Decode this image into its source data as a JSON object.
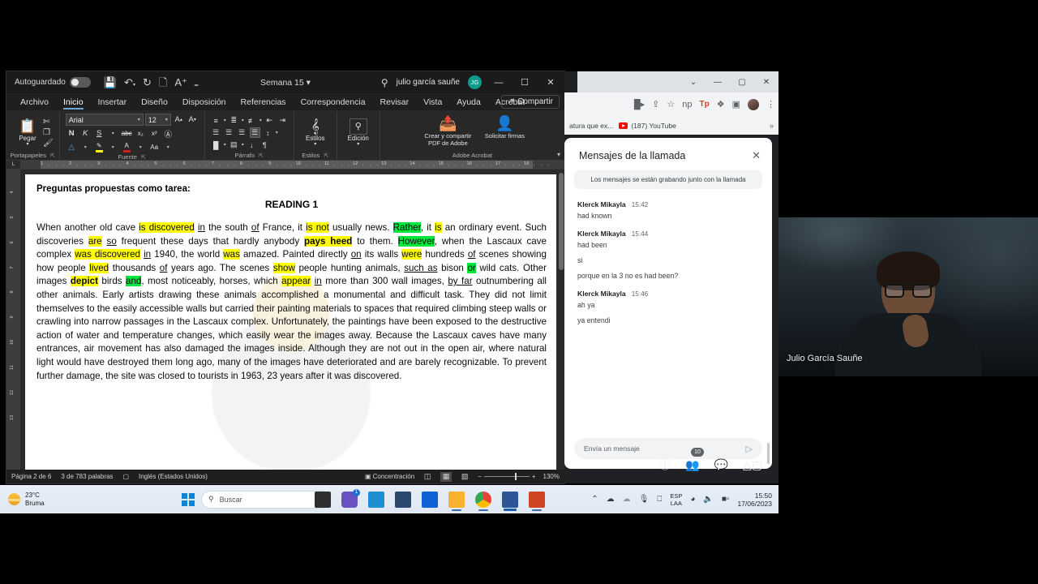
{
  "word": {
    "titlebar": {
      "autosave_label": "Autoguardado",
      "doc_title": "Semana 15",
      "doc_title_caret": "▾",
      "user_name": "julio garcía sauñe",
      "avatar_initials": "JG",
      "minimize": "—",
      "maximize": "☐",
      "close": "✕",
      "qat": [
        "save-icon",
        "undo-icon",
        "redo-icon",
        "new-icon",
        "read-aloud-icon",
        "customize-qat-icon"
      ],
      "search_icon": "search-icon"
    },
    "tabs": [
      {
        "label": "Archivo",
        "active": false
      },
      {
        "label": "Inicio",
        "active": true
      },
      {
        "label": "Insertar",
        "active": false
      },
      {
        "label": "Diseño",
        "active": false
      },
      {
        "label": "Disposición",
        "active": false
      },
      {
        "label": "Referencias",
        "active": false
      },
      {
        "label": "Correspondencia",
        "active": false
      },
      {
        "label": "Revisar",
        "active": false
      },
      {
        "label": "Vista",
        "active": false
      },
      {
        "label": "Ayuda",
        "active": false
      },
      {
        "label": "Acrobat",
        "active": false
      }
    ],
    "share_label": "Compartir",
    "ribbon": {
      "clipboard": {
        "label": "Portapapeles",
        "paste_label": "Pegar",
        "paste_caret": "▾",
        "cut_icon": "scissors-icon",
        "copy_icon": "copy-icon",
        "format_painter_icon": "format-painter-icon"
      },
      "font": {
        "label": "Fuente",
        "font_name": "Arial",
        "font_size": "12",
        "bold": "N",
        "italic": "K",
        "underline": "S",
        "strikethrough": "abc",
        "subscript": "x₂",
        "superscript": "x²",
        "clear_format_icon": "clear-formatting-icon",
        "text_effects_icon": "text-effects-icon",
        "highlight_icon": "highlight-color-icon",
        "font_color_icon": "font-color-icon",
        "change_case": "Aa",
        "grow_font": "A",
        "shrink_font": "A"
      },
      "paragraph": {
        "label": "Párrafo",
        "bullets_icon": "bullets-icon",
        "numbering_icon": "numbering-icon",
        "multilevel_icon": "multilevel-list-icon",
        "decrease_indent_icon": "decrease-indent-icon",
        "increase_indent_icon": "increase-indent-icon",
        "align_left_icon": "align-left-icon",
        "align_center_icon": "align-center-icon",
        "align_right_icon": "align-right-icon",
        "justify_icon": "justify-icon",
        "line_spacing_icon": "line-spacing-icon",
        "shading_icon": "shading-icon",
        "borders_icon": "borders-icon",
        "sort_icon": "sort-icon",
        "show_marks_icon": "show-formatting-marks-icon"
      },
      "styles": {
        "label": "Estilos",
        "button_label": "Estilos",
        "caret": "▾"
      },
      "editing": {
        "label": "Edición",
        "button_label": "Edición",
        "caret": "▾"
      },
      "acrobat": {
        "label": "Adobe Acrobat",
        "create_pdf_label": "Crear y compartir PDF de Adobe",
        "request_sign_label": "Solicitar firmas"
      },
      "collapse_caret": "▾"
    },
    "ruler": {
      "h_ticks": [
        "1",
        "2",
        "3",
        "4",
        "5",
        "6",
        "7",
        "8",
        "9",
        "10",
        "11",
        "12",
        "13",
        "14",
        "15",
        "16",
        "17",
        "18"
      ],
      "v_ticks": [
        "4",
        "5",
        "6",
        "7",
        "8",
        "9",
        "10",
        "11",
        "12",
        "13"
      ]
    },
    "document": {
      "heading": "Preguntas propuestas como tarea:",
      "subheading": "READING 1",
      "paragraph_runs": [
        {
          "t": "When another old cave ",
          "s": ""
        },
        {
          "t": "is discovered",
          "s": "hy"
        },
        {
          "t": " ",
          "s": ""
        },
        {
          "t": "in",
          "s": "u"
        },
        {
          "t": " the south ",
          "s": ""
        },
        {
          "t": "of",
          "s": "u"
        },
        {
          "t": " France, it ",
          "s": ""
        },
        {
          "t": "is not",
          "s": "hy"
        },
        {
          "t": " usually news. ",
          "s": ""
        },
        {
          "t": "Rather",
          "s": "hg"
        },
        {
          "t": ", it ",
          "s": ""
        },
        {
          "t": "is",
          "s": "hy"
        },
        {
          "t": " an ordinary event. Such discoveries ",
          "s": ""
        },
        {
          "t": "are",
          "s": "hy"
        },
        {
          "t": " ",
          "s": ""
        },
        {
          "t": "so",
          "s": "u"
        },
        {
          "t": " frequent these days that hardly anybody ",
          "s": ""
        },
        {
          "t": "pays heed",
          "s": "hy b"
        },
        {
          "t": " to them. ",
          "s": ""
        },
        {
          "t": "However",
          "s": "hg"
        },
        {
          "t": ", when the Lascaux cave complex ",
          "s": ""
        },
        {
          "t": "was discovered",
          "s": "hy"
        },
        {
          "t": " ",
          "s": ""
        },
        {
          "t": "in",
          "s": "u"
        },
        {
          "t": " 1940, the world ",
          "s": ""
        },
        {
          "t": "was",
          "s": "hy"
        },
        {
          "t": " amazed. Painted directly ",
          "s": ""
        },
        {
          "t": "on",
          "s": "u"
        },
        {
          "t": " its walls ",
          "s": ""
        },
        {
          "t": "were",
          "s": "hy"
        },
        {
          "t": " hundreds ",
          "s": ""
        },
        {
          "t": "of",
          "s": "u"
        },
        {
          "t": " scenes showing how people ",
          "s": ""
        },
        {
          "t": "lived",
          "s": "hy"
        },
        {
          "t": " thousands ",
          "s": ""
        },
        {
          "t": "of",
          "s": "u"
        },
        {
          "t": " years ago. The scenes ",
          "s": ""
        },
        {
          "t": "show",
          "s": "hy"
        },
        {
          "t": " people hunting animals, ",
          "s": ""
        },
        {
          "t": "such as",
          "s": "u"
        },
        {
          "t": " bison ",
          "s": ""
        },
        {
          "t": "or",
          "s": "hg"
        },
        {
          "t": " wild cats. Other images ",
          "s": ""
        },
        {
          "t": "depict",
          "s": "hy b"
        },
        {
          "t": " birds ",
          "s": ""
        },
        {
          "t": "and",
          "s": "hg"
        },
        {
          "t": ", most noticeably, horses, which ",
          "s": ""
        },
        {
          "t": "appear",
          "s": "hy"
        },
        {
          "t": " ",
          "s": ""
        },
        {
          "t": "in",
          "s": "u"
        },
        {
          "t": " more than 300 wall images, ",
          "s": ""
        },
        {
          "t": "by far",
          "s": "u"
        },
        {
          "t": " outnumbering all other animals. Early artists drawing these animals accomplished a monumental and difficult task. They did not limit themselves to the easily accessible walls but carried their painting materials to spaces that required climbing steep walls or crawling into narrow passages in the Lascaux complex. Unfortunately, the paintings have been exposed to the destructive action of water and temperature changes, which easily wear the images away. Because the Lascaux caves have many entrances, air movement has also damaged the images inside. Although they are not out in the open air, where natural light would have destroyed them long ago, many of the images have deteriorated and are barely recognizable. To prevent further damage, the site was closed to tourists in 1963, 23 years after it was discovered.",
          "s": ""
        }
      ]
    },
    "status": {
      "page": "Página 2 de 6",
      "words": "3 de 783 palabras",
      "proofing_icon": "proofing-icon",
      "language": "Inglés (Estados Unidos)",
      "focus_label": "Concentración",
      "view_read_icon": "read-mode-icon",
      "view_print_icon": "print-layout-icon",
      "view_web_icon": "web-layout-icon",
      "zoom_out": "−",
      "zoom_in": "+",
      "zoom_level": "130%"
    }
  },
  "chrome": {
    "window_buttons": {
      "restore_group": "⌄",
      "minimize": "—",
      "maximize": "▢",
      "close": "✕"
    },
    "toolbar_icons": [
      "video-camera-icon",
      "share-icon",
      "bookmark-star-icon",
      "np-extension-icon",
      "tp-extension-icon",
      "extensions-puzzle-icon",
      "sidebar-panel-icon",
      "profile-avatar-icon",
      "chrome-menu-icon"
    ],
    "tp_label": "Tp",
    "np_label": "np",
    "bookmarks": [
      {
        "label": "atura que ex...",
        "icon": "bookmark-icon"
      },
      {
        "label": "(187) YouTube",
        "icon": "youtube-icon"
      }
    ],
    "bookmarks_more": "»"
  },
  "meet": {
    "panel_title": "Mensajes de la llamada",
    "close_icon": "close-icon",
    "notice": "Los mensajes se están grabando junto con la llamada",
    "messages": [
      {
        "author": "Klerck Mikayla",
        "time": "15:42",
        "lines": [
          "had known"
        ]
      },
      {
        "author": "Klerck Mikayla",
        "time": "15:44",
        "lines": [
          "had been",
          "si",
          "porque en la 3 no es had been?"
        ]
      },
      {
        "author": "Klerck Mikayla",
        "time": "15:46",
        "lines": [
          "ah ya",
          "ya entendi"
        ]
      }
    ],
    "input_placeholder": "Envía un mensaje",
    "send_icon": "send-icon",
    "bottom_bar": {
      "info_icon": "info-icon",
      "people_icon": "people-icon",
      "chat_icon": "chat-icon",
      "activities_icon": "activities-icon",
      "people_badge": "10"
    }
  },
  "webcam": {
    "participant_name": "Julio García Sauñe"
  },
  "taskbar": {
    "weather": {
      "temp": "23°C",
      "condition": "Bruma",
      "icon": "haze-icon"
    },
    "start_icon": "windows-start-icon",
    "search_placeholder": "Buscar",
    "search_icon": "search-icon",
    "copilot_icon": "copilot-icon",
    "apps": [
      {
        "name": "task-view-icon",
        "badge": ""
      },
      {
        "name": "teams-icon",
        "badge": "1"
      },
      {
        "name": "teams-work-icon",
        "badge": ""
      },
      {
        "name": "sharepoint-icon",
        "badge": ""
      },
      {
        "name": "store-icon",
        "badge": ""
      },
      {
        "name": "dropbox-icon",
        "badge": ""
      },
      {
        "name": "file-explorer-icon",
        "badge": ""
      },
      {
        "name": "chrome-icon",
        "badge": ""
      },
      {
        "name": "word-icon",
        "badge": ""
      },
      {
        "name": "powerpoint-icon",
        "badge": ""
      }
    ],
    "tray": {
      "show_hidden": "⌃",
      "onedrive_icon": "onedrive-icon",
      "cloud_icon": "cloud-icon",
      "mic_icon": "microphone-icon",
      "touchpad_icon": "touchpad-icon",
      "lang_line1": "ESP",
      "lang_line2": "LAA",
      "wifi_icon": "wifi-icon",
      "volume_icon": "volume-icon",
      "battery_icon": "battery-icon",
      "time": "15:50",
      "date": "17/06/2023"
    }
  },
  "colors": {
    "highlight_yellow": "#ffff00",
    "highlight_green": "#00e83c",
    "word_accent": "#2b579a",
    "meet_blue": "#8ab4f8",
    "teal_avatar": "#0f9a8e"
  }
}
